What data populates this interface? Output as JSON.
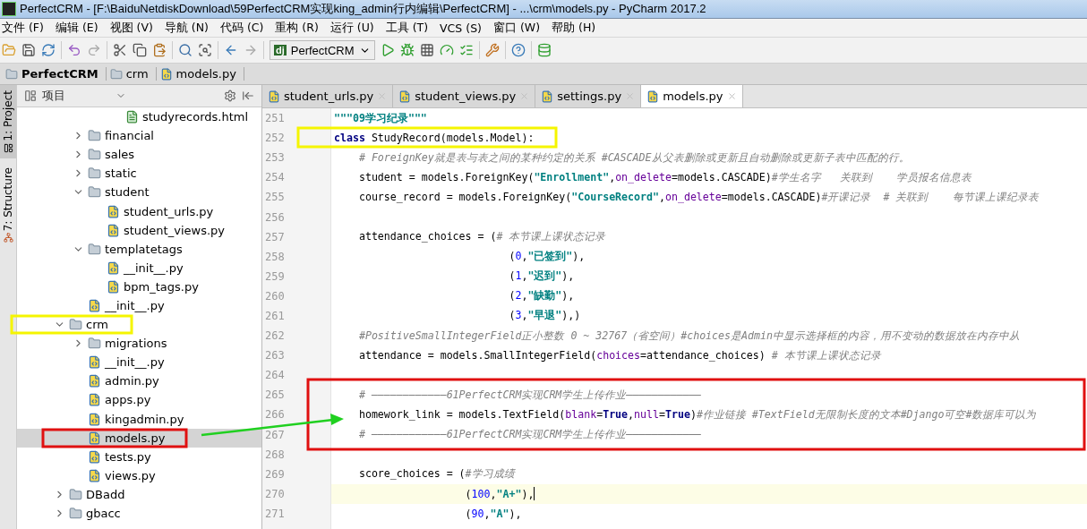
{
  "window": {
    "title": "PerfectCRM - [F:\\BaiduNetdiskDownload\\59PerfectCRM实现king_admin行内编辑\\PerfectCRM] - ...\\crm\\models.py - PyCharm 2017.2"
  },
  "menu": [
    "文件 (F)",
    "编辑 (E)",
    "视图 (V)",
    "导航 (N)",
    "代码 (C)",
    "重构 (R)",
    "运行 (U)",
    "工具 (T)",
    "VCS (S)",
    "窗口 (W)",
    "帮助 (H)"
  ],
  "toolbar": {
    "run_config_badge": "dj",
    "run_config": "PerfectCRM"
  },
  "breadcrumbs": [
    "PerfectCRM",
    "crm",
    "models.py"
  ],
  "side_tabs": [
    {
      "label": "1: Project",
      "selected": true
    },
    {
      "label": "7: Structure",
      "selected": false
    }
  ],
  "project_panel": {
    "title": "项目",
    "tree": [
      {
        "children": [
          {
            "children": [
              {
                "children": [
                  {
                    "label": "studyrecords.html",
                    "kind": "html",
                    "selected": false
                  }
                ]
              }
            ]
          },
          {
            "label": "financial",
            "kind": "folder",
            "expanded": false,
            "selected": false
          },
          {
            "label": "sales",
            "kind": "folder",
            "expanded": false,
            "selected": false
          },
          {
            "label": "static",
            "kind": "folder",
            "expanded": false,
            "selected": false
          },
          {
            "label": "student",
            "kind": "folder",
            "expanded": true,
            "selected": false,
            "children": [
              {
                "label": "student_urls.py",
                "kind": "python",
                "selected": false
              },
              {
                "label": "student_views.py",
                "kind": "python",
                "selected": false
              }
            ]
          },
          {
            "label": "templatetags",
            "kind": "folder",
            "expanded": true,
            "selected": false,
            "children": [
              {
                "label": "__init__.py",
                "kind": "python",
                "selected": false
              },
              {
                "label": "bpm_tags.py",
                "kind": "python",
                "selected": false
              }
            ]
          },
          {
            "label": "__init__.py",
            "kind": "python",
            "selected": false
          }
        ]
      },
      {
        "label": "crm",
        "kind": "folder",
        "expanded": true,
        "selected": false,
        "children": [
          {
            "label": "migrations",
            "kind": "folder",
            "expanded": false,
            "selected": false
          },
          {
            "label": "__init__.py",
            "kind": "python",
            "selected": false
          },
          {
            "label": "admin.py",
            "kind": "python",
            "selected": false
          },
          {
            "label": "apps.py",
            "kind": "python",
            "selected": false
          },
          {
            "label": "kingadmin.py",
            "kind": "python",
            "selected": false
          },
          {
            "label": "models.py",
            "kind": "python",
            "selected": true
          },
          {
            "label": "tests.py",
            "kind": "python",
            "selected": false
          },
          {
            "label": "views.py",
            "kind": "python",
            "selected": false
          }
        ]
      },
      {
        "label": "DBadd",
        "kind": "folder",
        "expanded": false,
        "selected": false
      },
      {
        "label": "gbacc",
        "kind": "folder",
        "expanded": false,
        "selected": false
      }
    ]
  },
  "editor": {
    "tabs": [
      {
        "label": "student_urls.py",
        "selected": false
      },
      {
        "label": "student_views.py",
        "selected": false
      },
      {
        "label": "settings.py",
        "selected": false
      },
      {
        "label": "models.py",
        "selected": true
      }
    ],
    "lines": [
      {
        "number": "251",
        "current": false,
        "tokens": [
          {
            "kind": "docstring",
            "text": "\"\"\"09学习纪录\"\"\""
          }
        ]
      },
      {
        "number": "252",
        "current": false,
        "tokens": [
          {
            "kind": "keyword",
            "text": "class"
          },
          {
            "kind": "plain",
            "text": " StudyRecord(models.Model):"
          }
        ]
      },
      {
        "number": "253",
        "current": false,
        "tokens": [
          {
            "kind": "comment",
            "text": "    # ForeignKey就是表与表之间的某种约定的关系 #CASCADE从父表删除或更新且自动删除或更新子表中匹配的行。"
          }
        ]
      },
      {
        "number": "254",
        "current": false,
        "tokens": [
          {
            "kind": "plain",
            "text": "    student = models.ForeignKey("
          },
          {
            "kind": "string",
            "text": "\"Enrollment\""
          },
          {
            "kind": "plain",
            "text": ","
          },
          {
            "kind": "param",
            "text": "on_delete"
          },
          {
            "kind": "plain",
            "text": "=models.CASCADE)"
          },
          {
            "kind": "comment",
            "text": "#学生名字   关联到    学员报名信息表"
          }
        ]
      },
      {
        "number": "255",
        "current": false,
        "tokens": [
          {
            "kind": "plain",
            "text": "    course_record = models.ForeignKey("
          },
          {
            "kind": "string",
            "text": "\"CourseRecord\""
          },
          {
            "kind": "plain",
            "text": ","
          },
          {
            "kind": "param",
            "text": "on_delete"
          },
          {
            "kind": "plain",
            "text": "=models.CASCADE)"
          },
          {
            "kind": "comment",
            "text": "#开课记录  # 关联到    每节课上课纪录表"
          }
        ]
      },
      {
        "number": "256",
        "current": false
      },
      {
        "number": "257",
        "current": false,
        "tokens": [
          {
            "kind": "plain",
            "text": "    attendance_choices = ("
          },
          {
            "kind": "comment",
            "text": "# 本节课上课状态记录"
          }
        ]
      },
      {
        "number": "258",
        "current": false,
        "tokens": [
          {
            "kind": "plain",
            "text": "                            ("
          },
          {
            "kind": "number",
            "text": "0"
          },
          {
            "kind": "plain",
            "text": ","
          },
          {
            "kind": "string",
            "text": "\"已签到\""
          },
          {
            "kind": "plain",
            "text": "),"
          }
        ]
      },
      {
        "number": "259",
        "current": false,
        "tokens": [
          {
            "kind": "plain",
            "text": "                            ("
          },
          {
            "kind": "number",
            "text": "1"
          },
          {
            "kind": "plain",
            "text": ","
          },
          {
            "kind": "string",
            "text": "\"迟到\""
          },
          {
            "kind": "plain",
            "text": "),"
          }
        ]
      },
      {
        "number": "260",
        "current": false,
        "tokens": [
          {
            "kind": "plain",
            "text": "                            ("
          },
          {
            "kind": "number",
            "text": "2"
          },
          {
            "kind": "plain",
            "text": ","
          },
          {
            "kind": "string",
            "text": "\"缺勤\""
          },
          {
            "kind": "plain",
            "text": "),"
          }
        ]
      },
      {
        "number": "261",
        "current": false,
        "tokens": [
          {
            "kind": "plain",
            "text": "                            ("
          },
          {
            "kind": "number",
            "text": "3"
          },
          {
            "kind": "plain",
            "text": ","
          },
          {
            "kind": "string",
            "text": "\"早退\""
          },
          {
            "kind": "plain",
            "text": "),)"
          }
        ]
      },
      {
        "number": "262",
        "current": false,
        "tokens": [
          {
            "kind": "comment",
            "text": "    #PositiveSmallIntegerField正小整数 0 ~ 32767（省空间）#choices是Admin中显示选择框的内容，用不变动的数据放在内存中从"
          }
        ]
      },
      {
        "number": "263",
        "current": false,
        "tokens": [
          {
            "kind": "plain",
            "text": "    attendance = models.SmallIntegerField("
          },
          {
            "kind": "param",
            "text": "choices"
          },
          {
            "kind": "plain",
            "text": "=attendance_choices) "
          },
          {
            "kind": "comment",
            "text": "# 本节课上课状态记录"
          }
        ]
      },
      {
        "number": "264",
        "current": false
      },
      {
        "number": "265",
        "current": false,
        "tokens": [
          {
            "kind": "comment",
            "text": "    # ————————————61PerfectCRM实现CRM学生上传作业————————————"
          }
        ]
      },
      {
        "number": "266",
        "current": false,
        "tokens": [
          {
            "kind": "plain",
            "text": "    homework_link = models.TextField("
          },
          {
            "kind": "param",
            "text": "blank"
          },
          {
            "kind": "plain",
            "text": "="
          },
          {
            "kind": "keyword",
            "text": "True"
          },
          {
            "kind": "plain",
            "text": ","
          },
          {
            "kind": "param",
            "text": "null"
          },
          {
            "kind": "plain",
            "text": "="
          },
          {
            "kind": "keyword",
            "text": "True"
          },
          {
            "kind": "plain",
            "text": ")"
          },
          {
            "kind": "comment",
            "text": "#作业链接 #TextField无限制长度的文本#Django可空#数据库可以为"
          }
        ]
      },
      {
        "number": "267",
        "current": false,
        "tokens": [
          {
            "kind": "comment",
            "text": "    # ————————————61PerfectCRM实现CRM学生上传作业————————————"
          }
        ]
      },
      {
        "number": "268",
        "current": false
      },
      {
        "number": "269",
        "current": false,
        "tokens": [
          {
            "kind": "plain",
            "text": "    score_choices = ("
          },
          {
            "kind": "comment",
            "text": "#学习成绩"
          }
        ]
      },
      {
        "number": "270",
        "current": true,
        "tokens": [
          {
            "kind": "plain",
            "text": "                     ("
          },
          {
            "kind": "number",
            "text": "100"
          },
          {
            "kind": "plain",
            "text": ","
          },
          {
            "kind": "string",
            "text": "\"A+\""
          },
          {
            "kind": "plain",
            "text": "),"
          }
        ]
      },
      {
        "number": "271",
        "current": false,
        "tokens": [
          {
            "kind": "plain",
            "text": "                     ("
          },
          {
            "kind": "number",
            "text": "90"
          },
          {
            "kind": "plain",
            "text": ","
          },
          {
            "kind": "string",
            "text": "\"A\""
          },
          {
            "kind": "plain",
            "text": "),"
          }
        ]
      }
    ]
  }
}
